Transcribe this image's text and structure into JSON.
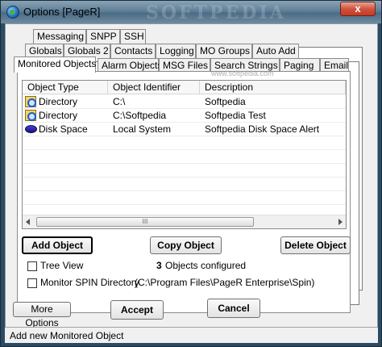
{
  "window": {
    "title": "Options [PageR]",
    "watermark": "SOFTPEDIA",
    "close_glyph": "x"
  },
  "tabs": {
    "row1": [
      "Messaging",
      "SNPP",
      "SSH"
    ],
    "row2": [
      "Globals",
      "Globals 2",
      "Contacts",
      "Logging",
      "MO Groups",
      "Auto Add"
    ],
    "row3": [
      "Monitored Objects",
      "Alarm Objects",
      "MSG Files",
      "Search Strings",
      "Paging",
      "Email"
    ],
    "active": "Monitored Objects"
  },
  "list": {
    "watermark": "www.softpedia.com",
    "columns": [
      "Object Type",
      "Object Identifier",
      "Description"
    ],
    "rows": [
      {
        "icon": "directory-icon",
        "type": "Directory",
        "identifier": "C:\\",
        "description": "Softpedia"
      },
      {
        "icon": "directory-icon",
        "type": "Directory",
        "identifier": "C:\\Softpedia",
        "description": "Softpedia Test"
      },
      {
        "icon": "disk-space-icon",
        "type": "Disk Space",
        "identifier": "Local System",
        "description": "Softpedia Disk Space Alert"
      }
    ],
    "scroll_thumb_grip": "III"
  },
  "buttons": {
    "add_object": "Add Object",
    "copy_object": "Copy Object",
    "delete_object": "Delete Object",
    "more_options": "More Options",
    "accept": "Accept",
    "cancel": "Cancel"
  },
  "options": {
    "tree_view_label": "Tree View",
    "objects_count": "3",
    "objects_configured_text": "Objects configured",
    "monitor_spin_label": "Monitor SPIN Directory",
    "spin_path": "(C:\\Program Files\\PageR Enterprise\\Spin)"
  },
  "status": {
    "text": "Add new Monitored Object"
  }
}
